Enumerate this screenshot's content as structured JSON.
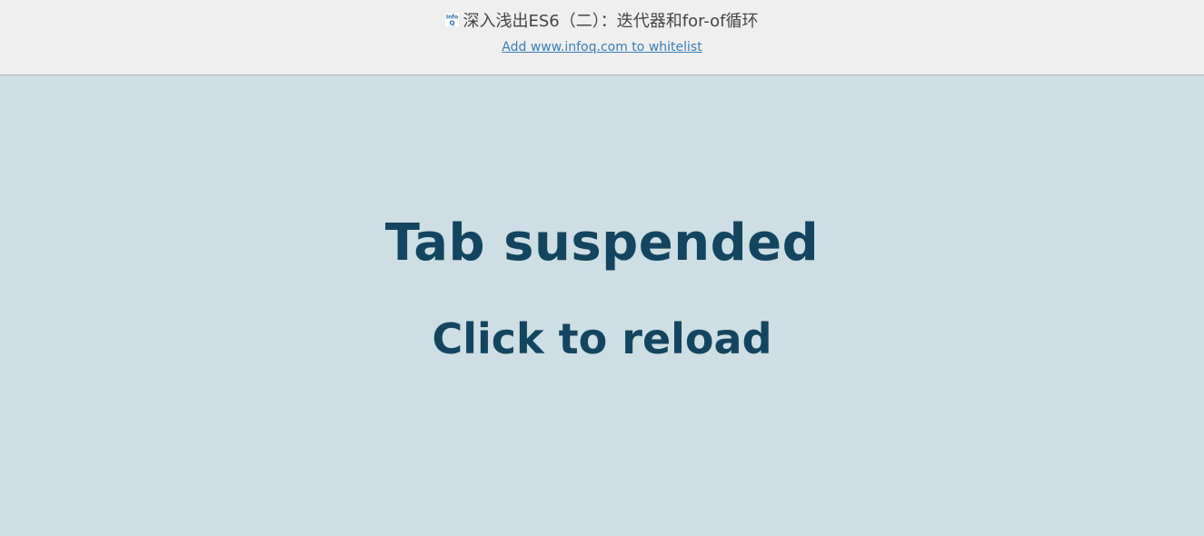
{
  "header": {
    "favicon_icon": "infoq-favicon-icon",
    "favicon_text_top": "Info",
    "favicon_text_bottom": "Q",
    "title": "深入浅出ES6（二）：迭代器和for-of循环",
    "whitelist_link": "Add www.infoq.com to whitelist"
  },
  "main": {
    "heading": "Tab suspended",
    "subheading": "Click to reload"
  },
  "colors": {
    "header_bg": "#efefef",
    "main_bg": "#cddfe4",
    "heading_text": "#15455e",
    "link": "#3a7fb5"
  }
}
